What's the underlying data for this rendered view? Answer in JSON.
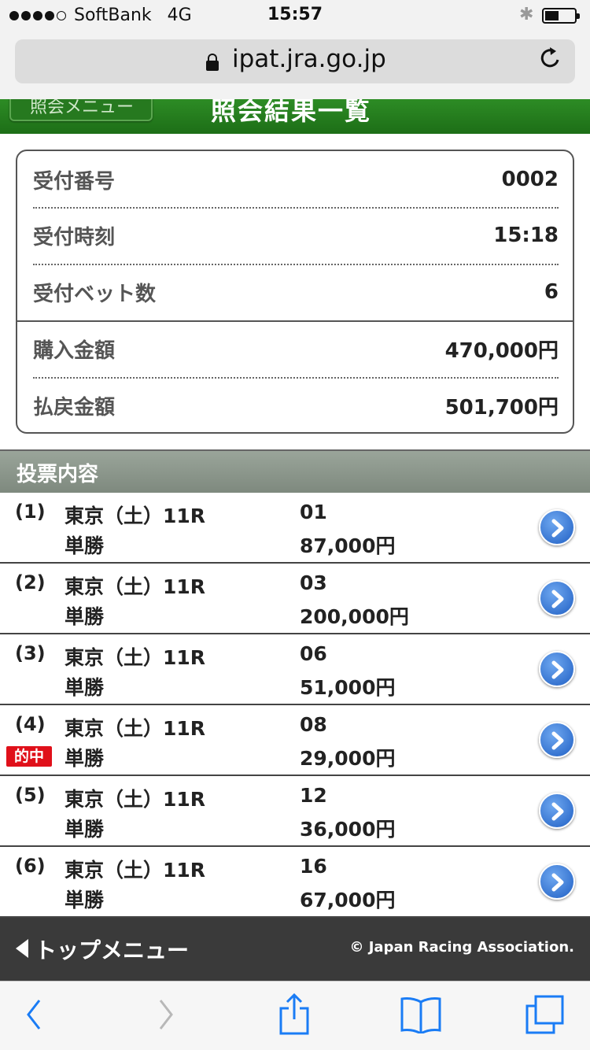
{
  "status_bar": {
    "carrier": "SoftBank",
    "network": "4G",
    "time": "15:57"
  },
  "browser": {
    "url": "ipat.jra.go.jp"
  },
  "header": {
    "back_label": "照会メニュー",
    "title": "照会結果一覧"
  },
  "summary": [
    {
      "label": "受付番号",
      "value": "0002"
    },
    {
      "label": "受付時刻",
      "value": "15:18"
    },
    {
      "label": "受付ベット数",
      "value": "6"
    },
    {
      "label": "購入金額",
      "value": "470,000円"
    },
    {
      "label": "払戻金額",
      "value": "501,700円"
    }
  ],
  "section_title": "投票内容",
  "bets": [
    {
      "index": "(1)",
      "race": "東京（土）11R",
      "type": "単勝",
      "horse": "01",
      "amount": "87,000円",
      "hit": ""
    },
    {
      "index": "(2)",
      "race": "東京（土）11R",
      "type": "単勝",
      "horse": "03",
      "amount": "200,000円",
      "hit": ""
    },
    {
      "index": "(3)",
      "race": "東京（土）11R",
      "type": "単勝",
      "horse": "06",
      "amount": "51,000円",
      "hit": ""
    },
    {
      "index": "(4)",
      "race": "東京（土）11R",
      "type": "単勝",
      "horse": "08",
      "amount": "29,000円",
      "hit": "的中"
    },
    {
      "index": "(5)",
      "race": "東京（土）11R",
      "type": "単勝",
      "horse": "12",
      "amount": "36,000円",
      "hit": ""
    },
    {
      "index": "(6)",
      "race": "東京（土）11R",
      "type": "単勝",
      "horse": "16",
      "amount": "67,000円",
      "hit": ""
    }
  ],
  "footer": {
    "top_menu": "トップメニュー",
    "copyright": "© Japan Racing Association."
  },
  "colors": {
    "header_green": "#26791f",
    "section_gray": "#8a948a",
    "hit_red": "#e0101a",
    "arrow_blue": "#2a6fd6",
    "footer_dark": "#3a3a3a"
  },
  "icons": [
    "lock-icon",
    "reload-icon",
    "arrow-right-icon",
    "back-triangle-icon",
    "back-icon",
    "forward-icon",
    "share-icon",
    "bookmarks-icon",
    "tabs-icon"
  ]
}
